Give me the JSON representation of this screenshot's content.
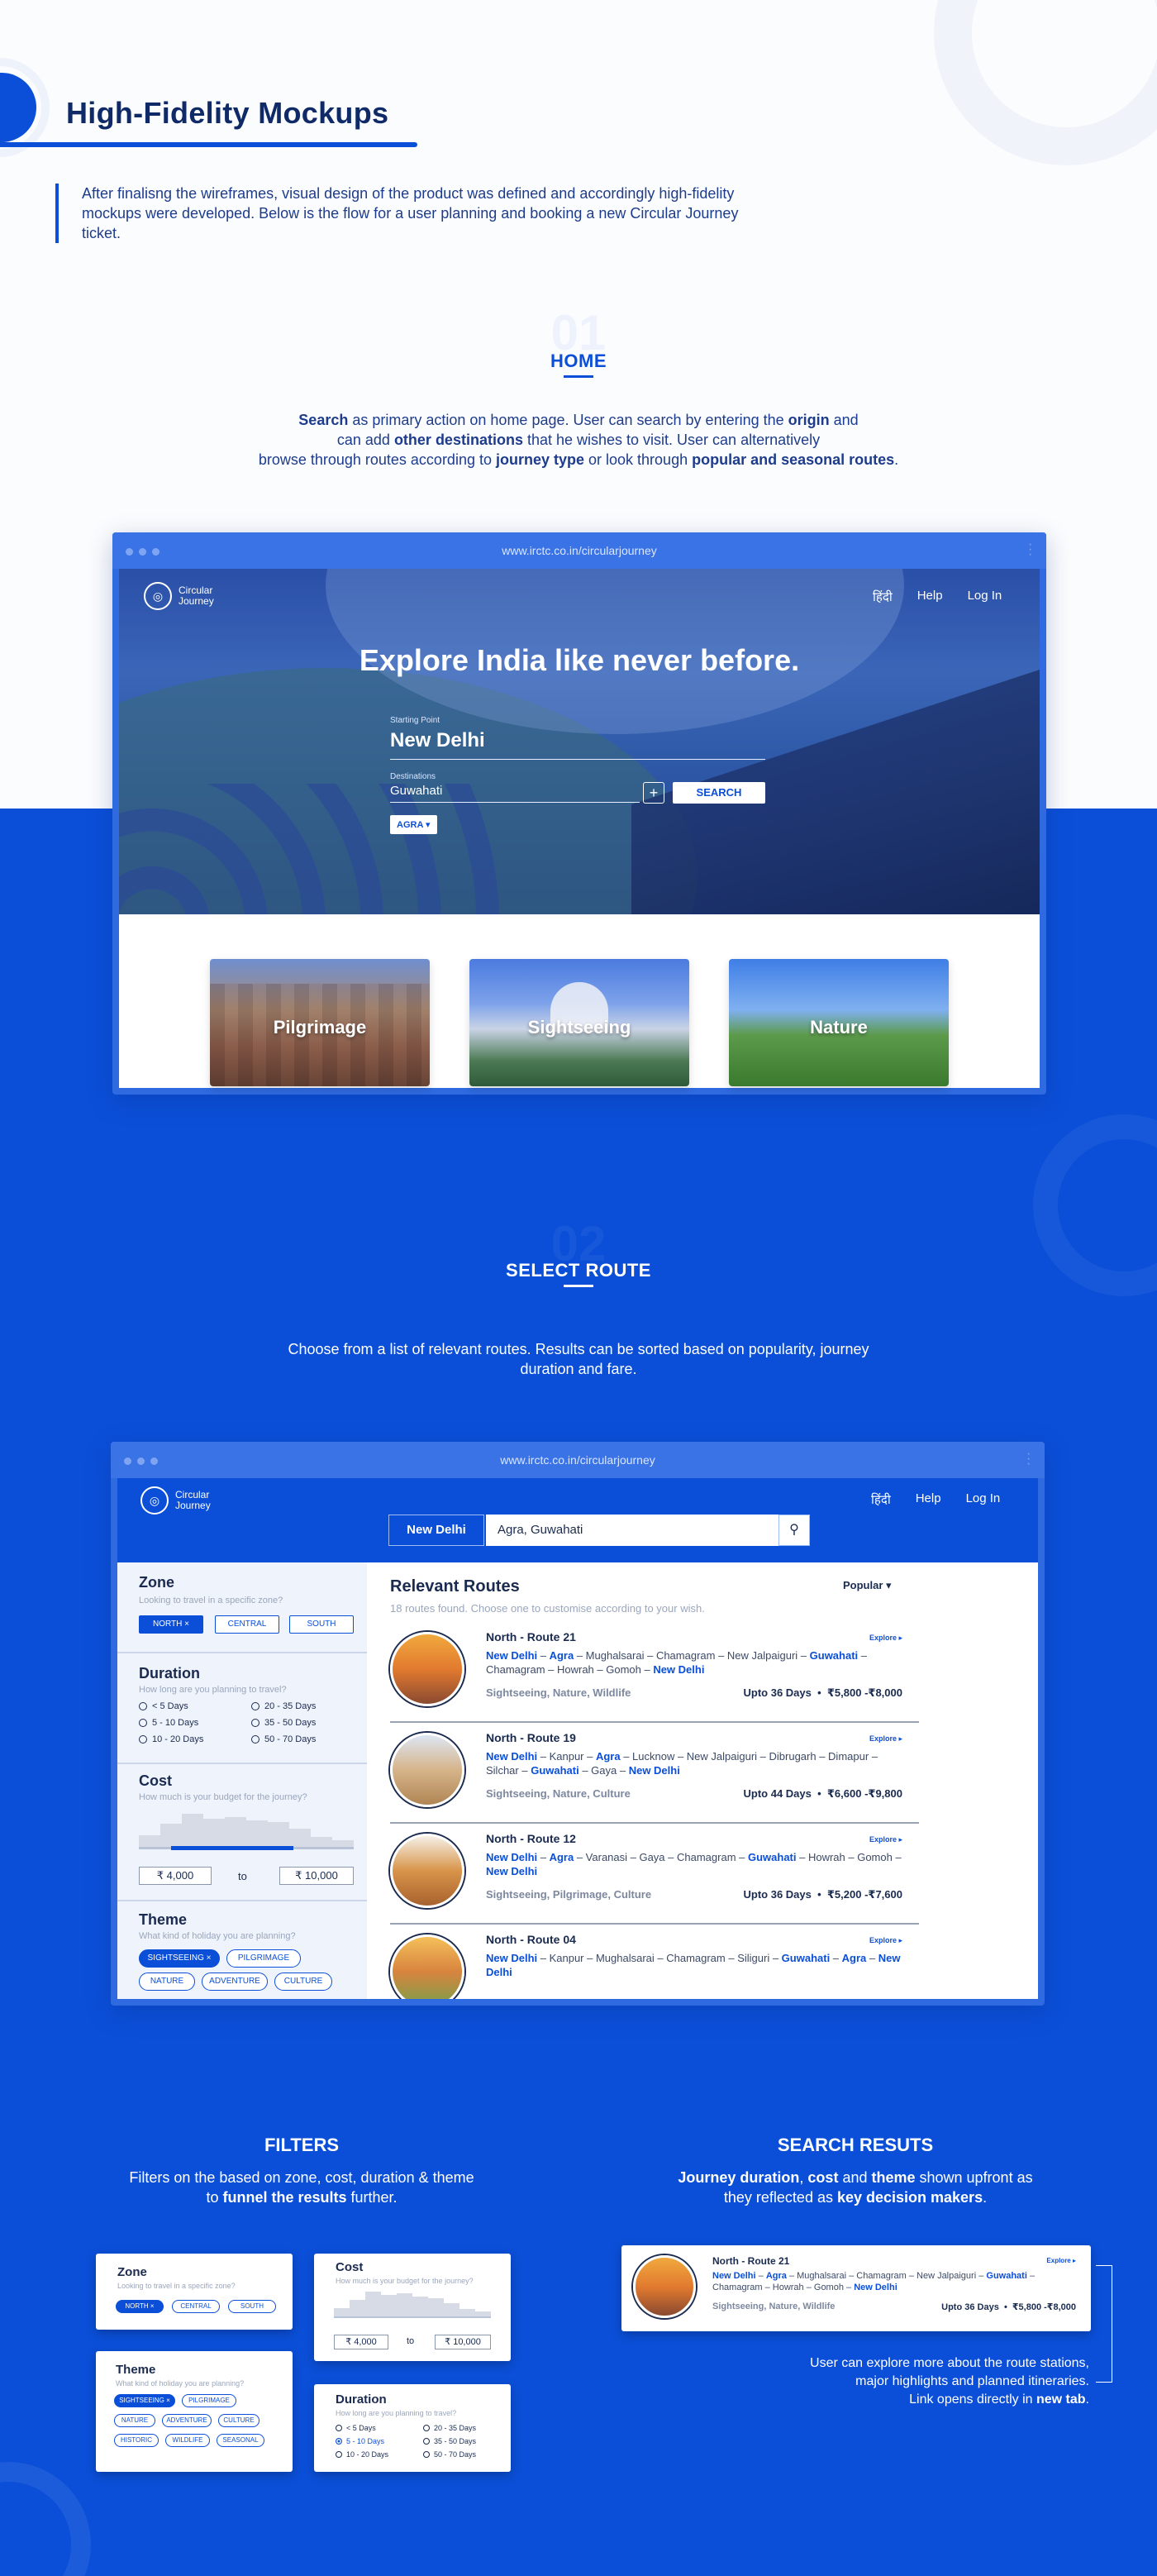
{
  "page": {
    "title": "High-Fidelity Mockups",
    "intro": "After finalisng the wireframes, visual design of the product was defined and accordingly high-fidelity mockups were developed. Below is the flow for a user planning and booking a new Circular Journey ticket."
  },
  "home": {
    "number": "01",
    "title": "HOME",
    "desc_parts": [
      "Search",
      " as primary action on home page. User can search by entering the ",
      "origin",
      " and",
      "can add ",
      "other destinations",
      " that he wishes to visit. User can alternatively",
      "browse through routes according to ",
      "journey type",
      " or look through ",
      "popular and seasonal routes",
      "."
    ]
  },
  "browser": {
    "url": "www.irctc.co.in/circularjourney"
  },
  "site": {
    "logo_line1": "Circular",
    "logo_line2": "Journey",
    "nav": [
      "हिंदी",
      "Help",
      "Log In"
    ]
  },
  "hero": {
    "headline": "Explore India like never before.",
    "start_label": "Starting Point",
    "start_value": "New Delhi",
    "dest_label": "Destinations",
    "dest_value": "Guwahati",
    "add_symbol": "+",
    "search_label": "SEARCH",
    "chip": "AGRA"
  },
  "journey_types": [
    "Pilgrimage",
    "Sightseeing",
    "Nature"
  ],
  "select_route": {
    "number": "02",
    "title": "SELECT ROUTE",
    "desc": "Choose from a list of relevant routes. Results can be sorted based on popularity, journey duration and fare.",
    "search_origin": "New Delhi",
    "search_dest": "Agra, Guwahati",
    "heading": "Relevant Routes",
    "found": "18 routes found. Choose one to customise according to your wish.",
    "sort": "Popular"
  },
  "filters": {
    "zone": {
      "title": "Zone",
      "sub": "Looking to travel in a specific zone?",
      "options": [
        "NORTH",
        "CENTRAL",
        "SOUTH"
      ],
      "selected": "NORTH"
    },
    "duration": {
      "title": "Duration",
      "sub": "How long are you planning to travel?",
      "options": [
        "< 5 Days",
        "20 - 35 Days",
        "5 - 10 Days",
        "35 - 50 Days",
        "10 - 20 Days",
        "50 - 70 Days"
      ]
    },
    "cost": {
      "title": "Cost",
      "sub": "How much is your budget for the journey?",
      "min": "₹ 4,000",
      "to": "to",
      "max": "₹ 10,000",
      "range_fraction": [
        0.15,
        0.72
      ]
    },
    "theme": {
      "title": "Theme",
      "sub": "What kind of holiday you are planning?",
      "options": [
        "SIGHTSEEING",
        "PILGRIMAGE",
        "NATURE",
        "ADVENTURE",
        "CULTURE",
        "HISTORIC",
        "WILDLIFE",
        "SEASONAL"
      ]
    }
  },
  "routes": [
    {
      "name": "North - Route 21",
      "path_html": "<b>New Delhi</b> – <b>Agra</b> – Mughalsarai – Chamagram – New Jalpaiguri – <b>Guwahati</b> – Chamagram – Howrah – Gomoh – <b>New Delhi</b>",
      "theme": "Sightseeing, Nature, Wildlife",
      "days": "Upto 36 Days",
      "fare": "₹5,800 -₹8,000",
      "explore": "Explore ▸"
    },
    {
      "name": "North - Route 19",
      "path_html": "<b>New Delhi</b> – Kanpur – <b>Agra</b> – Lucknow – New Jalpaiguri – Dibrugarh – Dimapur – Silchar – <b>Guwahati</b> – Gaya – <b>New Delhi</b>",
      "theme": "Sightseeing, Nature, Culture",
      "days": "Upto 44 Days",
      "fare": "₹6,600 -₹9,800",
      "explore": "Explore ▸"
    },
    {
      "name": "North - Route 12",
      "path_html": "<b>New Delhi</b> – <b>Agra</b> – Varanasi – Gaya – Chamagram – <b>Guwahati</b> – Howrah – Gomoh – <b>New Delhi</b>",
      "theme": "Sightseeing, Pilgrimage, Culture",
      "days": "Upto 36 Days",
      "fare": "₹5,200 -₹7,600",
      "explore": "Explore ▸"
    },
    {
      "name": "North - Route 04",
      "path_html": "<b>New Delhi</b> – Kanpur – Mughalsarai – Chamagram – Siliguri – <b>Guwahati</b> – <b>Agra</b> – <b>New Delhi</b>",
      "theme": "",
      "days": "",
      "fare": "",
      "explore": "Explore ▸"
    }
  ],
  "filters_section": {
    "title": "FILTERS",
    "desc_line1": "Filters on the based on zone, cost, duration & theme",
    "desc_line2_a": "to ",
    "desc_line2_b": "funnel the results",
    "desc_line2_c": " further."
  },
  "results_section": {
    "title": "SEARCH RESUTS",
    "d1": "Journey duration",
    "d2": ", ",
    "d3": "cost",
    "d4": " and ",
    "d5": "theme",
    "d6": " shown upfront as",
    "d7": "they reflected as ",
    "d8": "key decision makers",
    "d9": ".",
    "note1": "User can explore more about the route stations,",
    "note2": "major highlights and planned itineraries.",
    "note3a": "Link opens directly in ",
    "note3b": "new tab",
    "note3c": "."
  },
  "colors": {
    "brand_blue": "#0b4fd8",
    "navy": "#0f2a66",
    "bg_light": "#fbfcfe"
  }
}
